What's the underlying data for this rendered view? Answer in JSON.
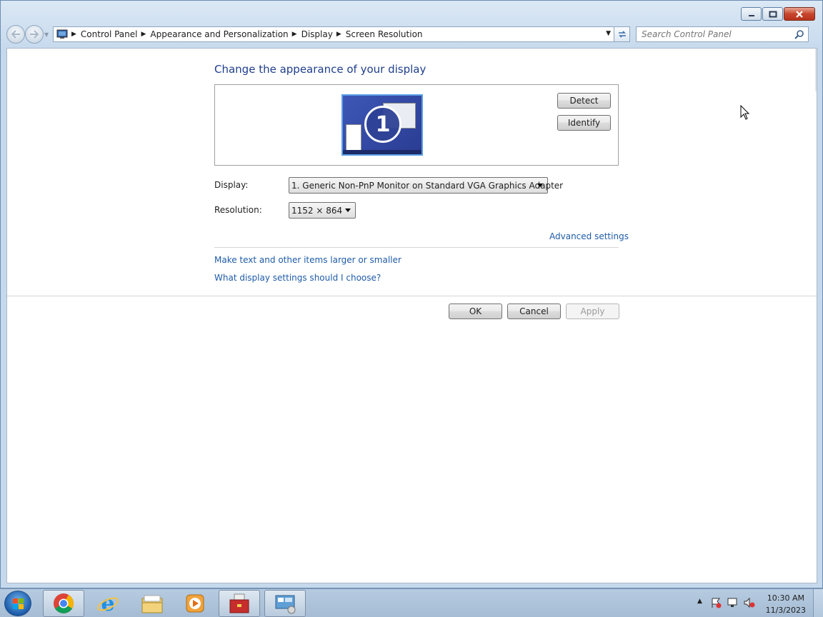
{
  "address": {
    "crumbs": [
      "Control Panel",
      "Appearance and Personalization",
      "Display",
      "Screen Resolution"
    ]
  },
  "search": {
    "placeholder": "Search Control Panel"
  },
  "main": {
    "heading": "Change the appearance of your display",
    "monitor_number": "1",
    "detect_label": "Detect",
    "identify_label": "Identify",
    "display_label": "Display:",
    "display_value": "1. Generic Non-PnP Monitor on Standard VGA Graphics Adapter",
    "resolution_label": "Resolution:",
    "resolution_value": "1152 × 864",
    "advanced_link": "Advanced settings",
    "links": [
      "Make text and other items larger or smaller",
      "What display settings should I choose?"
    ],
    "ok_label": "OK",
    "cancel_label": "Cancel",
    "apply_label": "Apply"
  },
  "taskbar": {
    "apps": [
      "chrome-icon",
      "internet-explorer-icon",
      "file-explorer-icon",
      "media-player-icon",
      "toolbox-icon",
      "display-settings-icon"
    ],
    "time": "10:30 AM",
    "date": "11/3/2023"
  },
  "colors": {
    "heading": "#1e3e8c",
    "link": "#1e5ba8",
    "accent": "#3d57b7"
  }
}
